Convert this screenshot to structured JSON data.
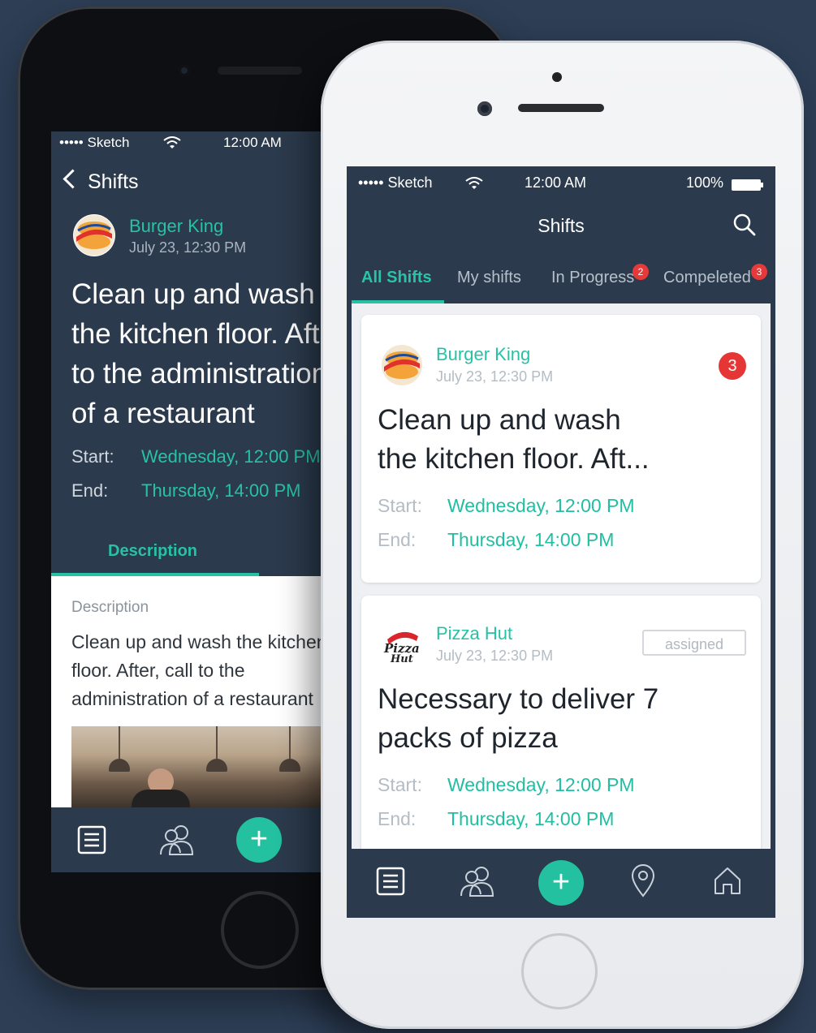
{
  "back_phone": {
    "status": {
      "carrier": "••••• Sketch",
      "time": "12:00 AM"
    },
    "nav": {
      "back_label": "Shifts"
    },
    "shift": {
      "company": "Burger King",
      "date": "July 23, 12:30 PM",
      "title_lines": [
        "Clean up and wash",
        "the kitchen floor. After, call",
        "to the administration",
        "of a restaurant"
      ],
      "start_label": "Start:",
      "start_value": "Wednesday, 12:00 PM",
      "end_label": "End:",
      "end_value": "Thursday, 14:00 PM"
    },
    "tab": {
      "label": "Description"
    },
    "description": {
      "heading": "Description",
      "lines": [
        "Clean up and wash the kitchen",
        "floor. After, call to the",
        "administration of a restaurant"
      ]
    },
    "tabbar_icons": [
      "list-icon",
      "people-icon",
      "add-icon"
    ]
  },
  "front_phone": {
    "status": {
      "carrier": "••••• Sketch",
      "time": "12:00 AM",
      "battery": "100%"
    },
    "header": {
      "title": "Shifts"
    },
    "tabs": [
      {
        "label": "All Shifts",
        "badge": ""
      },
      {
        "label": "My shifts",
        "badge": ""
      },
      {
        "label": "In Progress",
        "badge": "2"
      },
      {
        "label": "Compeleted",
        "badge": "3"
      }
    ],
    "cards": [
      {
        "company": "Burger King",
        "date": "July 23, 12:30 PM",
        "title_lines": [
          "Clean up and wash",
          "the kitchen floor. Aft..."
        ],
        "count": "3",
        "start_label": "Start:",
        "start_value": "Wednesday, 12:00 PM",
        "end_label": "End:",
        "end_value": "Thursday, 14:00 PM"
      },
      {
        "company": "Pizza Hut",
        "date": "July 23, 12:30 PM",
        "title_lines": [
          "Necessary to deliver 7",
          "packs of pizza"
        ],
        "status_tag": "assigned",
        "start_label": "Start:",
        "start_value": "Wednesday, 12:00 PM",
        "end_label": "End:",
        "end_value": "Thursday, 14:00 PM"
      }
    ],
    "logos": {
      "burger_king": "BURGER KING",
      "pizza_hut": "Pizza Hut"
    },
    "tabbar_icons": [
      "list-icon",
      "people-icon",
      "add-icon",
      "location-pin-icon",
      "home-icon"
    ]
  },
  "colors": {
    "background": "#2d3e55",
    "accent": "#27c2a5",
    "badge": "#e53535",
    "screen": "#2b3a4c"
  }
}
